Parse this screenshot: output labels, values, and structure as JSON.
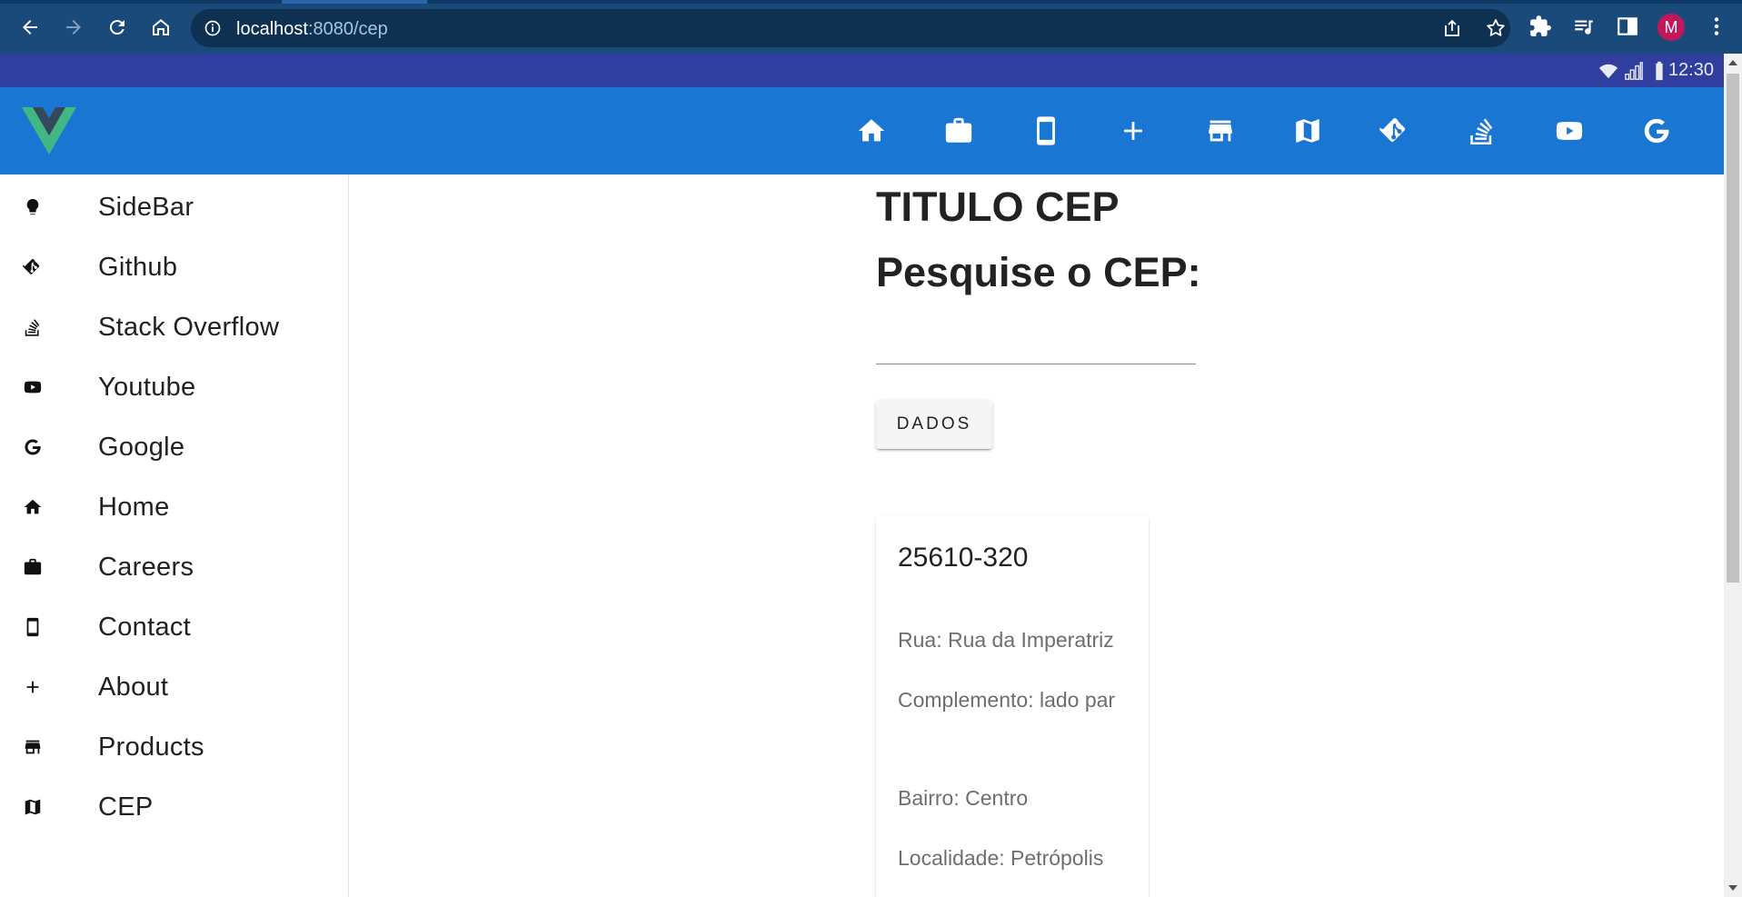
{
  "browser": {
    "url_host": "localhost",
    "url_rest": ":8080/cep",
    "profile_initial": "M"
  },
  "statusbar": {
    "time": "12:30",
    "icons": [
      "wifi-icon",
      "signal-icon",
      "battery-icon"
    ]
  },
  "appbar": {
    "logo": "vue-logo",
    "icons": [
      "home-icon",
      "briefcase-icon",
      "phone-icon",
      "plus-icon",
      "store-icon",
      "map-icon",
      "git-icon",
      "stack-overflow-icon",
      "youtube-icon",
      "google-icon"
    ]
  },
  "sidebar": {
    "items": [
      {
        "label": "SideBar",
        "icon": "lightbulb-icon"
      },
      {
        "label": "Github",
        "icon": "git-icon"
      },
      {
        "label": "Stack Overflow",
        "icon": "stack-overflow-icon"
      },
      {
        "label": "Youtube",
        "icon": "youtube-icon"
      },
      {
        "label": "Google",
        "icon": "google-icon"
      },
      {
        "label": "Home",
        "icon": "home-icon"
      },
      {
        "label": "Careers",
        "icon": "briefcase-icon"
      },
      {
        "label": "Contact",
        "icon": "phone-icon"
      },
      {
        "label": "About",
        "icon": "plus-icon"
      },
      {
        "label": "Products",
        "icon": "store-icon"
      },
      {
        "label": "CEP",
        "icon": "map-icon"
      }
    ]
  },
  "main": {
    "title": "TITULO CEP",
    "subtitle": "Pesquise o CEP:",
    "search_value": "",
    "button_label": "DADOS",
    "result": {
      "cep": "25610-320",
      "rua": "Rua: Rua da Imperatriz",
      "complemento": "Complemento: lado par",
      "bairro": "Bairro: Centro",
      "localidade": "Localidade: Petrópolis"
    }
  },
  "colors": {
    "chrome": "#1a4a7a",
    "statusbar": "#303f9f",
    "appbar": "#1976d2",
    "logo_green": "#41b883",
    "logo_dark": "#35495e"
  }
}
